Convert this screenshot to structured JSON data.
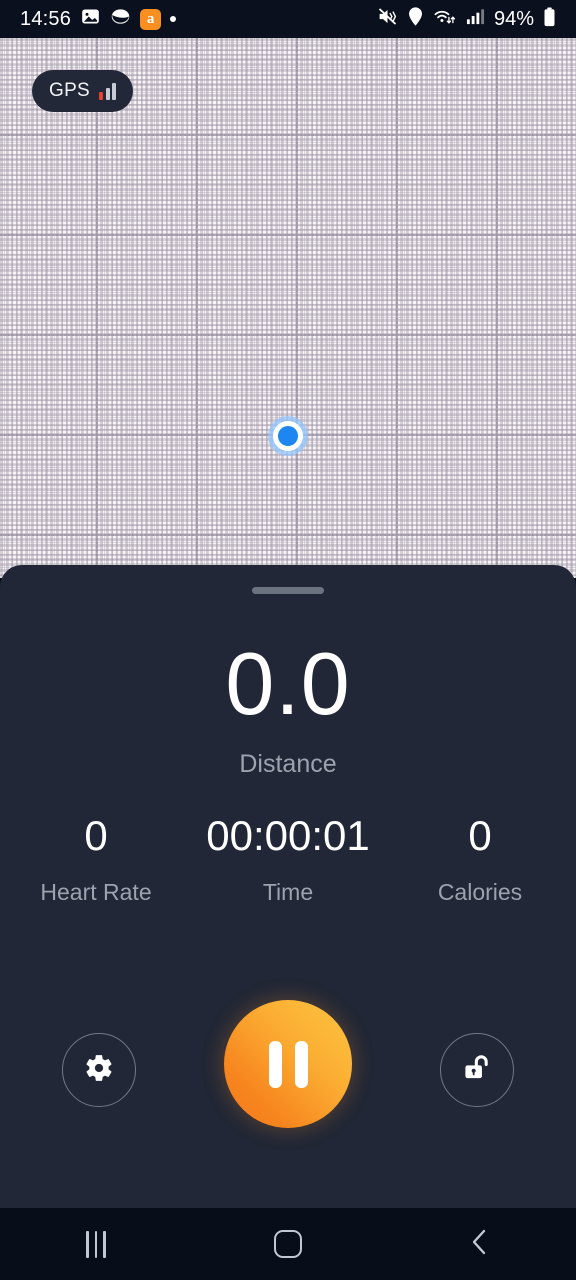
{
  "status_bar": {
    "time": "14:56",
    "left_icons": [
      "gallery-icon",
      "samsung-internet-icon",
      "app-orange-badge-icon",
      "status-dot-icon"
    ],
    "app_badge_letter": "a",
    "right_icons": [
      "mute-vibrate-icon",
      "location-pin-icon",
      "wifi-transfer-icon",
      "cellular-signal-icon"
    ],
    "battery_percent": "94%"
  },
  "map": {
    "gps_badge_label": "GPS",
    "gps_signal_strength": 3,
    "gps_signal_active_color": "#e8412c",
    "gps_signal_inactive_color": "#c8ccd6",
    "background_color": "#f7f3f6",
    "location_marker": "current-location-marker"
  },
  "panel": {
    "drag_handle": "sheet-drag-handle",
    "background_color": "#212736",
    "primary_metric": {
      "value": "0.0",
      "label": "Distance"
    },
    "stats": [
      {
        "value": "0",
        "label": "Heart Rate"
      },
      {
        "value": "00:00:01",
        "label": "Time"
      },
      {
        "value": "0",
        "label": "Calories"
      }
    ],
    "controls": {
      "settings_icon": "gear-icon",
      "pause_icon": "pause-icon",
      "lock_icon": "unlocked-padlock-icon",
      "pause_accent_color": "#f7861f"
    }
  },
  "nav_bar": {
    "recents_icon": "recents-icon",
    "home_icon": "home-icon",
    "back_icon": "back-chevron-icon"
  }
}
